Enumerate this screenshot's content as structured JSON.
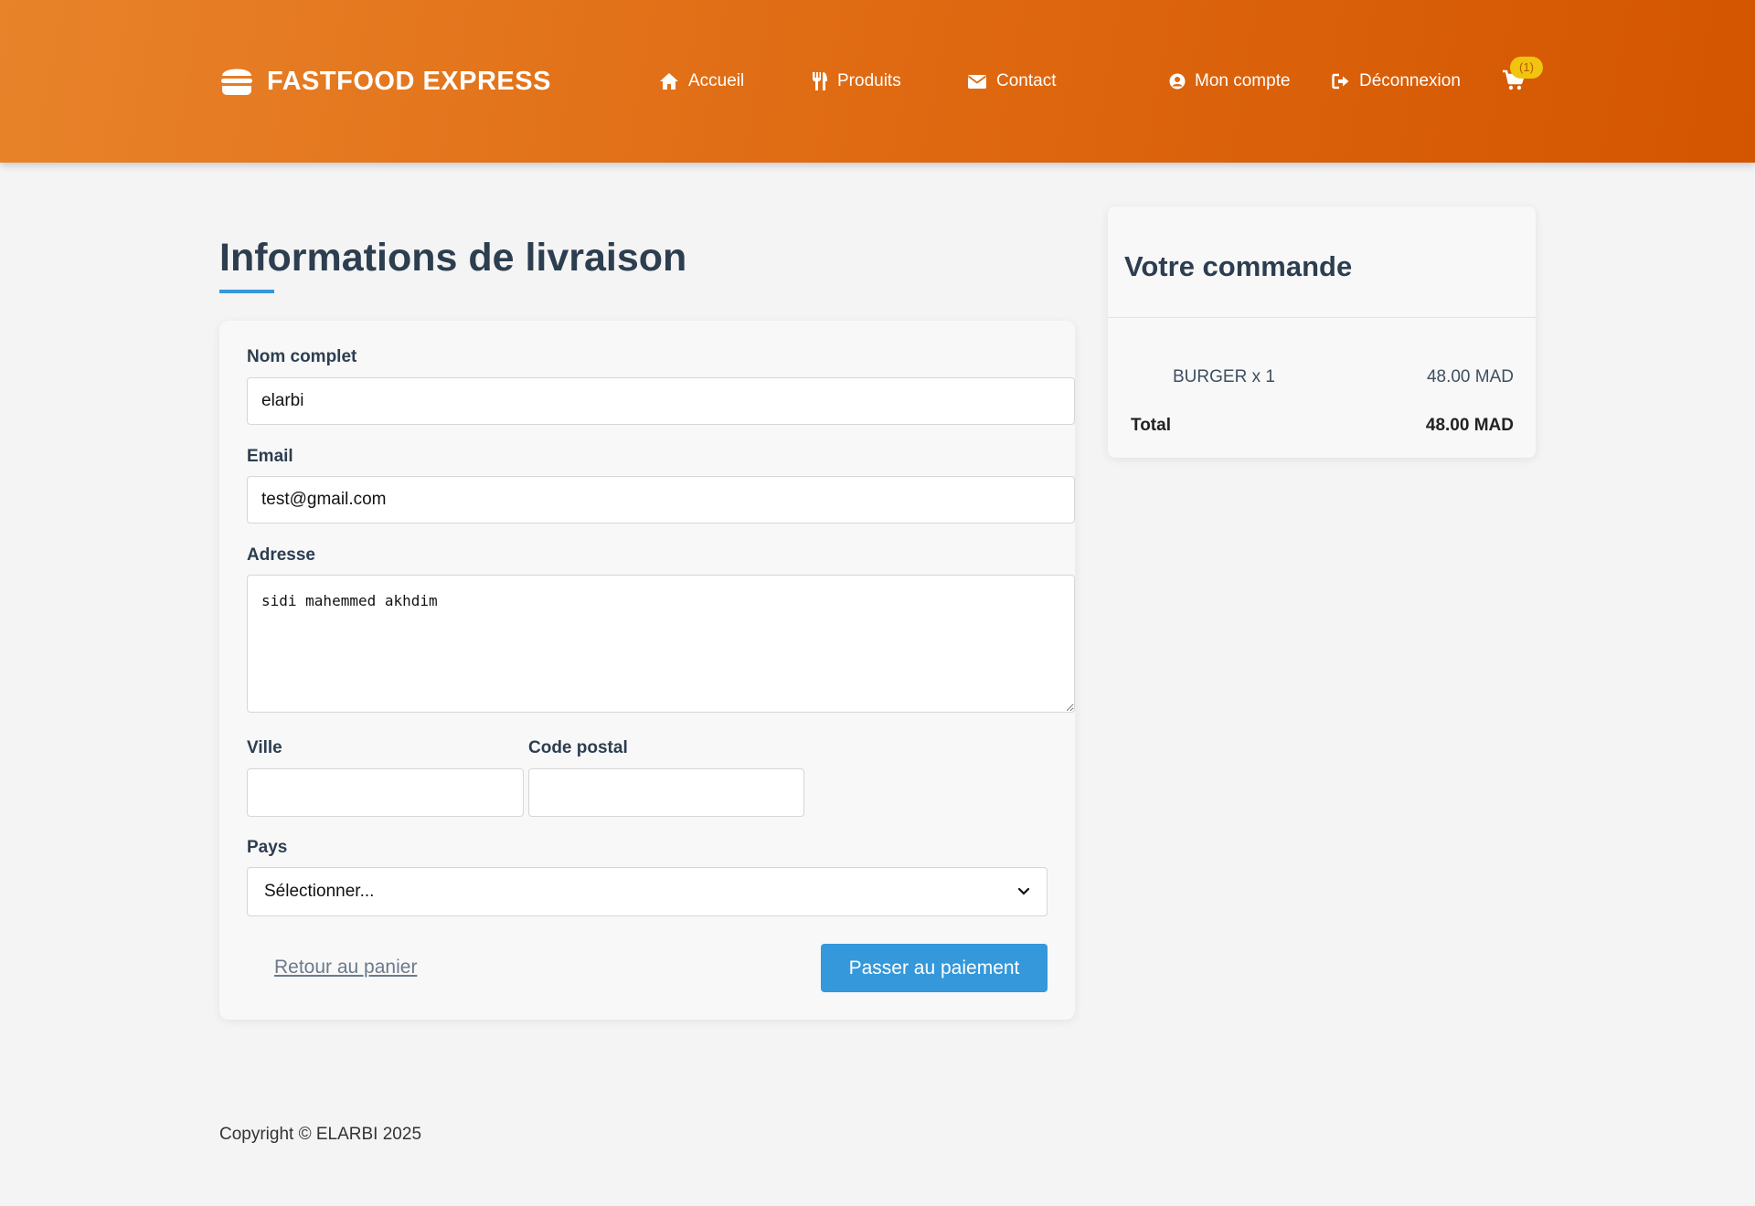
{
  "header": {
    "brand": "FASTFOOD EXPRESS",
    "brand_icon": "burger-icon",
    "nav": [
      {
        "label": "Accueil",
        "icon": "home-icon"
      },
      {
        "label": "Produits",
        "icon": "utensils-icon"
      },
      {
        "label": "Contact",
        "icon": "envelope-icon"
      }
    ],
    "account": {
      "label": "Mon compte",
      "icon": "user-circle-icon"
    },
    "logout": {
      "label": "Déconnexion",
      "icon": "sign-out-icon"
    },
    "cart": {
      "icon": "cart-icon",
      "badge": "(1)"
    }
  },
  "page": {
    "title": "Informations de livraison"
  },
  "form": {
    "name": {
      "label": "Nom complet",
      "value": "elarbi"
    },
    "email": {
      "label": "Email",
      "value": "test@gmail.com"
    },
    "address": {
      "label": "Adresse",
      "value": "sidi mahemmed akhdim"
    },
    "city": {
      "label": "Ville",
      "value": ""
    },
    "postal": {
      "label": "Code postal",
      "value": ""
    },
    "country": {
      "label": "Pays",
      "selected": "Sélectionner..."
    },
    "back_label": "Retour au panier",
    "submit_label": "Passer au paiement"
  },
  "summary": {
    "title": "Votre commande",
    "items": [
      {
        "name": "BURGER x 1",
        "price": "48.00 MAD"
      }
    ],
    "total_label": "Total",
    "total_value": "48.00 MAD"
  },
  "footer": {
    "copyright": "Copyright © ELARBI 2025"
  },
  "colors": {
    "header_start": "#e8832a",
    "header_end": "#d45500",
    "accent": "#3498db",
    "badge": "#f1c40f",
    "heading": "#2c3e50"
  }
}
